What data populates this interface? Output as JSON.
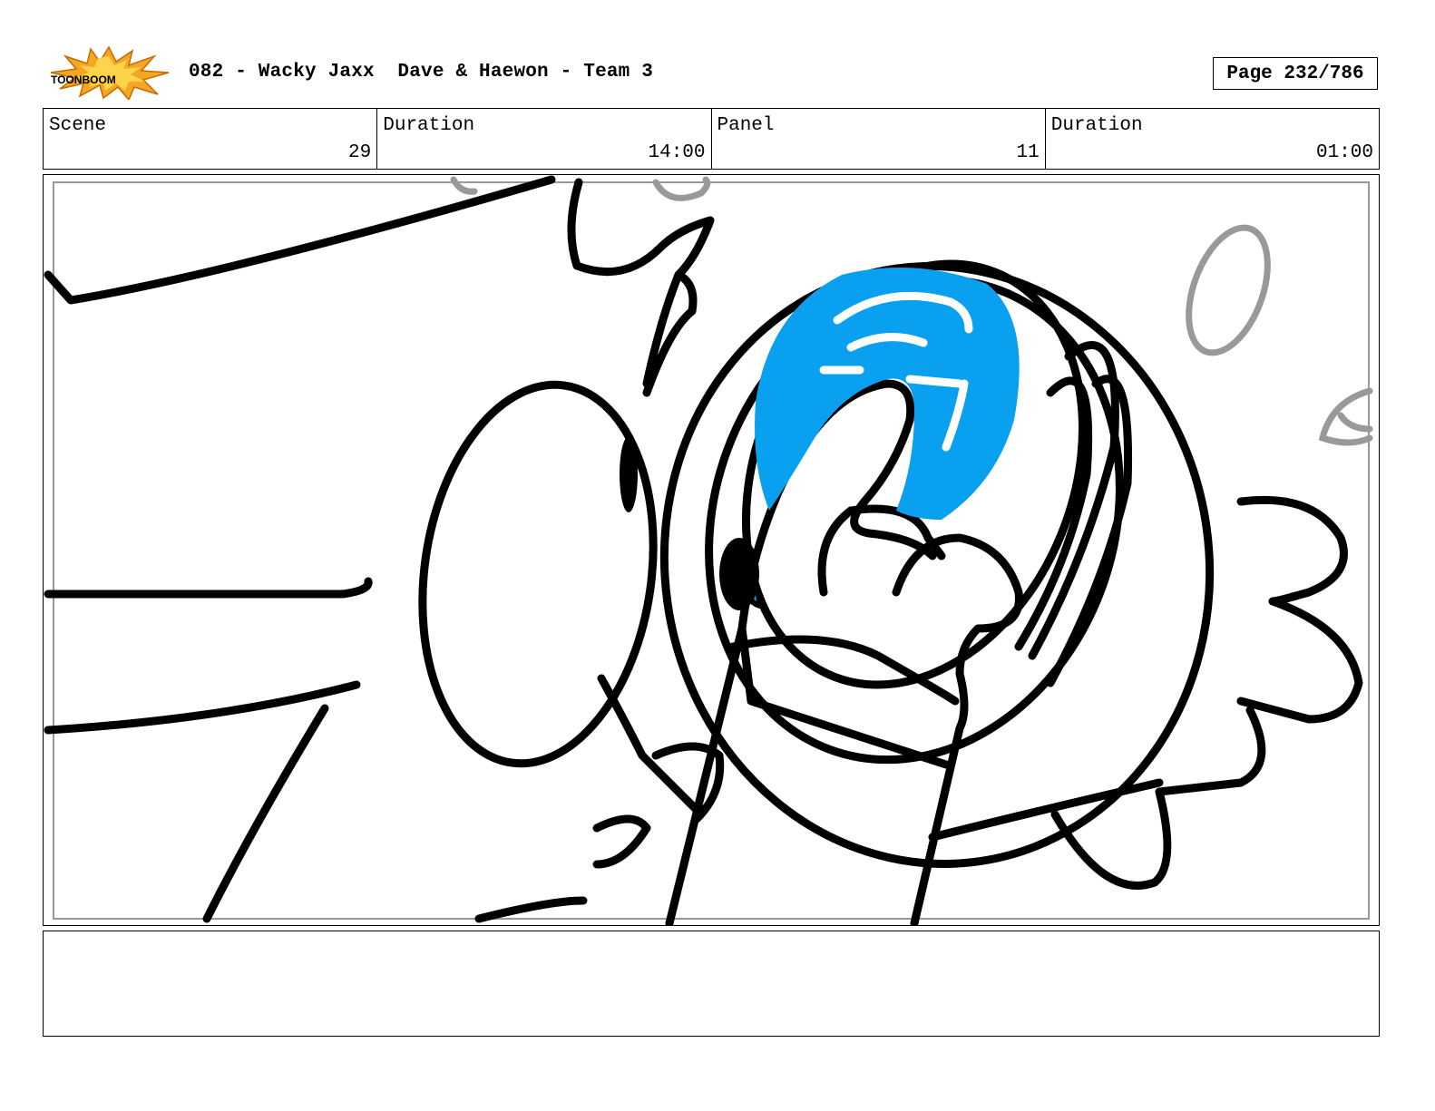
{
  "header": {
    "logo_text": "TOONBOOM",
    "title": "082 - Wacky Jaxx  Dave & Haewon - Team 3",
    "page_label": "Page 232/786"
  },
  "info": {
    "scene_label": "Scene",
    "scene_value": "29",
    "scene_duration_label": "Duration",
    "scene_duration_value": "14:00",
    "panel_label": "Panel",
    "panel_value": "11",
    "panel_duration_label": "Duration",
    "panel_duration_value": "01:00"
  },
  "panel": {
    "image": "storyboard-drawing-finger-pressing-blue-button"
  },
  "notes": {
    "text": ""
  },
  "colors": {
    "accent_blue": "#0aa0f0",
    "logo_orange": "#f5a623",
    "line": "#000000",
    "rough_gray": "#999999"
  }
}
